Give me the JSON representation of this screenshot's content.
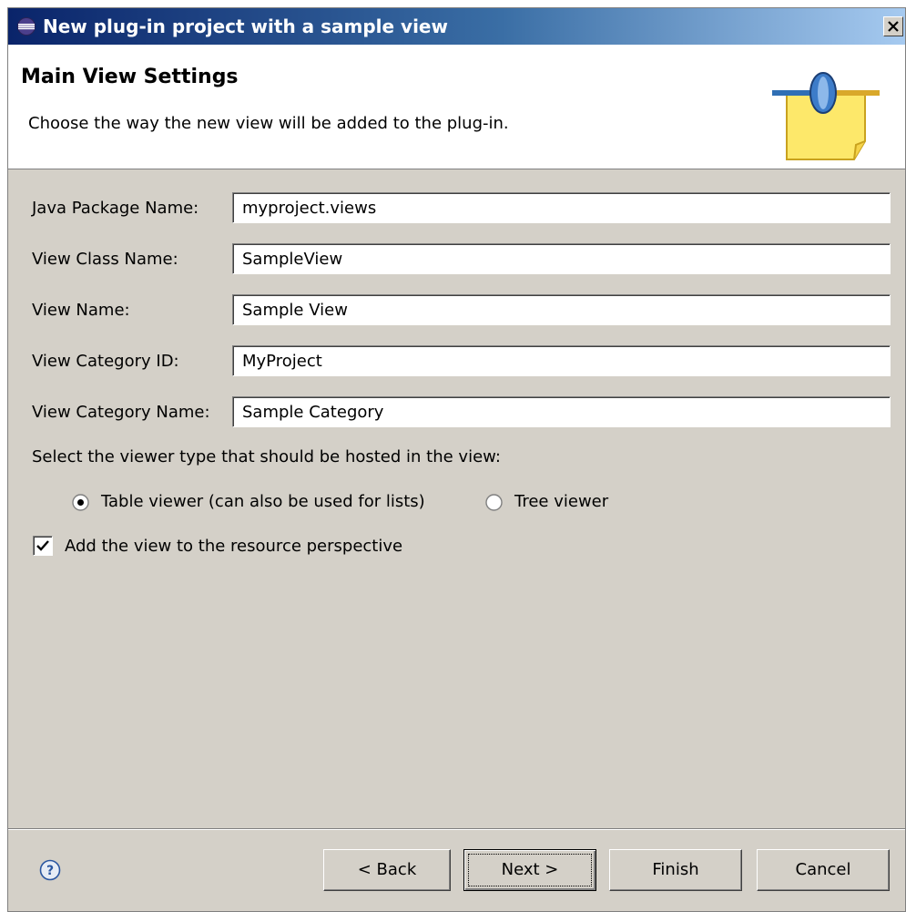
{
  "window": {
    "title": "New plug-in project with a sample view"
  },
  "header": {
    "title": "Main View Settings",
    "description": "Choose the way the new view will be added to the plug-in."
  },
  "form": {
    "fields": [
      {
        "label": "Java Package Name:",
        "value": "myproject.views"
      },
      {
        "label": "View Class Name:",
        "value": "SampleView"
      },
      {
        "label": "View Name:",
        "value": "Sample View"
      },
      {
        "label": "View Category ID:",
        "value": "MyProject"
      },
      {
        "label": "View Category Name:",
        "value": "Sample Category"
      }
    ],
    "viewer_prompt": "Select the viewer type that should be hosted in the view:",
    "viewer_options": [
      {
        "label": "Table viewer (can also be used for lists)",
        "selected": true
      },
      {
        "label": "Tree viewer",
        "selected": false
      }
    ],
    "add_to_perspective": {
      "label": "Add the view to the resource perspective",
      "checked": true
    }
  },
  "buttons": {
    "back": "< Back",
    "next": "Next >",
    "finish": "Finish",
    "cancel": "Cancel"
  },
  "icons": {
    "title": "eclipse-icon",
    "close": "close-icon",
    "header": "plugin-connector-icon",
    "help": "help-icon"
  },
  "colors": {
    "titlebar_start": "#0a246a",
    "titlebar_end": "#a6caf0",
    "dialog_bg": "#d4d0c8",
    "header_bg": "#ffffff"
  }
}
